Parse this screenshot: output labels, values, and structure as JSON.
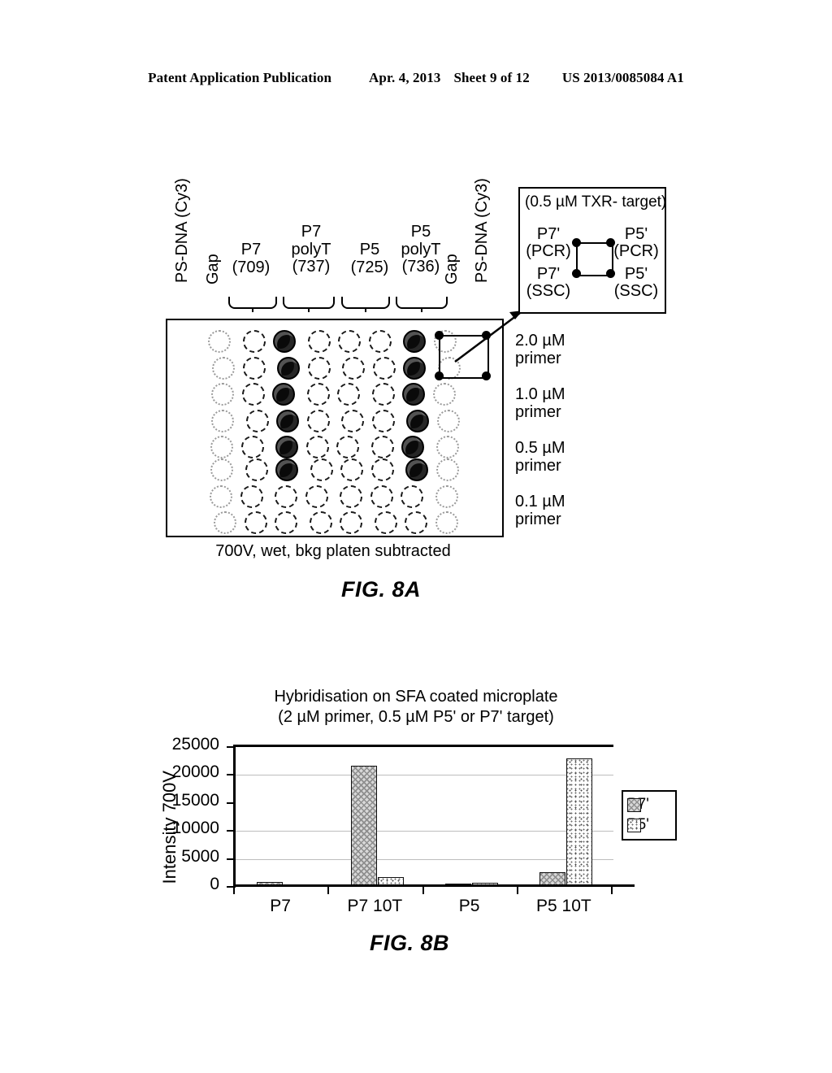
{
  "header": {
    "publication": "Patent Application Publication",
    "date": "Apr. 4, 2013",
    "sheet": "Sheet 9 of 12",
    "number": "US 2013/0085084 A1"
  },
  "fig8a": {
    "name": "FIG. 8A",
    "caption": "700V, wet, bkg platen subtracted",
    "column_headers": [
      {
        "line1": "PS-DNA (Cy3)",
        "line2": "",
        "line3": "",
        "vertical": true
      },
      {
        "line1": "Gap",
        "line2": "",
        "line3": "",
        "vertical": true
      },
      {
        "line1": "",
        "line2": "P7",
        "line3": "(709)",
        "vertical": false
      },
      {
        "line1": "P7",
        "line2": "polyT",
        "line3": "(737)",
        "vertical": false
      },
      {
        "line1": "",
        "line2": "P5",
        "line3": "(725)",
        "vertical": false
      },
      {
        "line1": "P5",
        "line2": "polyT",
        "line3": "(736)",
        "vertical": false
      },
      {
        "line1": "Gap",
        "line2": "",
        "line3": "",
        "vertical": true
      },
      {
        "line1": "PS-DNA (Cy3)",
        "line2": "",
        "line3": "",
        "vertical": true
      }
    ],
    "row_labels": [
      {
        "conc": "2.0 µM",
        "unit": "primer"
      },
      {
        "conc": "1.0 µM",
        "unit": "primer"
      },
      {
        "conc": "0.5 µM",
        "unit": "primer"
      },
      {
        "conc": "0.1 µM",
        "unit": "primer"
      }
    ],
    "inset": {
      "title": "(0.5 µM TXR- target)",
      "top_left": "P7'\n(PCR)",
      "top_left_l1": "P7'",
      "top_left_l2": "(PCR)",
      "top_right_l1": "P5'",
      "top_right_l2": "(PCR)",
      "bottom_left_l1": "P7'",
      "bottom_left_l2": "(SSC)",
      "bottom_right_l1": "P5'",
      "bottom_right_l2": "(SSC)"
    },
    "array": {
      "rows": 8,
      "cols": 8,
      "filled_columns": [
        2,
        6
      ],
      "filled_rows": [
        0,
        1,
        2,
        3,
        4,
        5
      ],
      "note": "dark spots appear in the P7 polyT and P5 polyT columns for the top six rows"
    }
  },
  "chart_data": {
    "type": "bar",
    "title": "Hybridisation on SFA coated microplate\n(2 µM primer, 0.5 µM P5' or P7' target)",
    "title_line1": "Hybridisation on SFA coated microplate",
    "title_line2": "(2 µM primer, 0.5 µM P5' or P7' target)",
    "xlabel": "",
    "ylabel": "Intensity 700V",
    "ylim": [
      0,
      25000
    ],
    "ytick_labels": [
      "25000",
      "20000",
      "15000",
      "10000",
      "5000",
      "0"
    ],
    "ytick_values": [
      25000,
      20000,
      15000,
      10000,
      5000,
      0
    ],
    "grid": true,
    "legend_position": "right",
    "categories": [
      "P7",
      "P7 10T",
      "P5",
      "P5 10T"
    ],
    "series": [
      {
        "name": "P7'",
        "values": [
          900,
          21700,
          600,
          2600
        ]
      },
      {
        "name": "P5'",
        "values": [
          450,
          1750,
          750,
          23000
        ]
      }
    ]
  },
  "fig8b": {
    "name": "FIG. 8B"
  }
}
